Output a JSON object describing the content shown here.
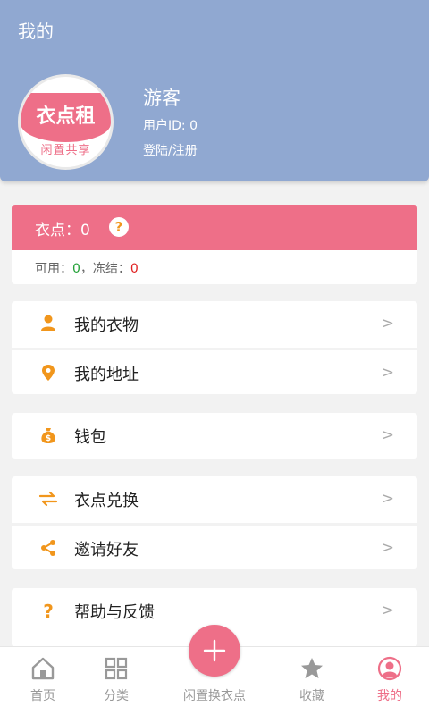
{
  "header": {
    "title": "我的",
    "logo": {
      "name": "衣点租",
      "tagline": "闲置共享"
    },
    "user_name": "游客",
    "user_id": "用户ID: 0",
    "login_link": "登陆/注册"
  },
  "points": {
    "label": "衣点：0",
    "help_icon": "?",
    "available_label": "可用：",
    "available_value": "0",
    "separator": "，",
    "frozen_label": "冻结：",
    "frozen_value": "0"
  },
  "menu": [
    {
      "label": "我的衣物",
      "icon": "person-icon",
      "arrow": ">"
    },
    {
      "label": "我的地址",
      "icon": "location-pin-icon",
      "arrow": ">"
    },
    {
      "label": "钱包",
      "icon": "money-bag-icon",
      "arrow": ">"
    },
    {
      "label": "衣点兑换",
      "icon": "exchange-arrows-icon",
      "arrow": ">"
    },
    {
      "label": "邀请好友",
      "icon": "share-icon",
      "arrow": ">"
    },
    {
      "label": "帮助与反馈",
      "icon": "question-icon",
      "arrow": ">"
    }
  ],
  "tabbar": [
    {
      "label": "首页",
      "icon": "home-icon"
    },
    {
      "label": "分类",
      "icon": "grid-icon"
    },
    {
      "label": "闲置换衣点",
      "icon": "plus-icon"
    },
    {
      "label": "收藏",
      "icon": "star-icon"
    },
    {
      "label": "我的",
      "icon": "profile-circle-icon",
      "active": true
    }
  ],
  "colors": {
    "header": "#90a8d1",
    "accent": "#ee6f88",
    "icon_orange": "#f1961c"
  }
}
